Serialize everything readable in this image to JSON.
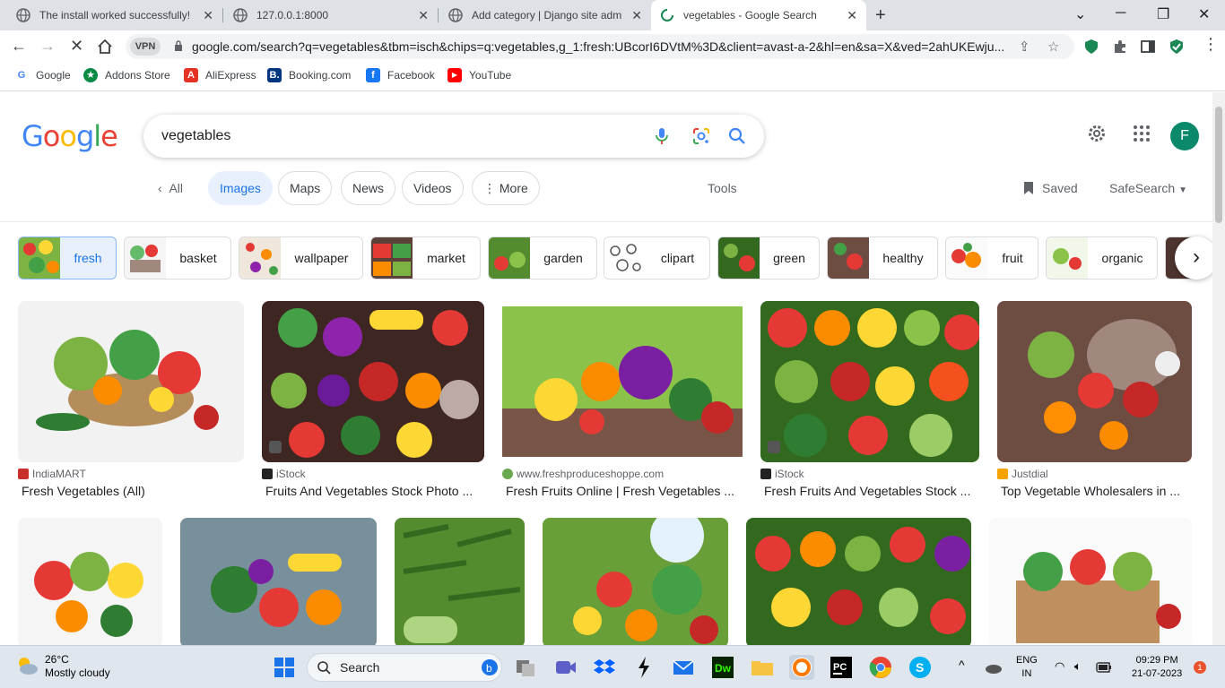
{
  "tabs": [
    {
      "title": "The install worked successfully! C",
      "close": "✕"
    },
    {
      "title": "127.0.0.1:8000",
      "close": "✕"
    },
    {
      "title": "Add category | Django site admin",
      "close": "✕"
    },
    {
      "title": "vegetables - Google Search",
      "close": "✕"
    }
  ],
  "new_tab": "+",
  "address": {
    "vpn": "VPN",
    "url": "google.com/search?q=vegetables&tbm=isch&chips=q:vegetables,g_1:fresh:UBcorI6DVtM%3D&client=avast-a-2&hl=en&sa=X&ved=2ahUKEwju..."
  },
  "bookmarks": [
    {
      "label": "Google",
      "icon": "G",
      "color": "#ffffff"
    },
    {
      "label": "Addons Store",
      "icon": "★",
      "color": "#0b8a44"
    },
    {
      "label": "AliExpress",
      "icon": "A",
      "color": "#e43225"
    },
    {
      "label": "Booking.com",
      "icon": "B.",
      "color": "#003580"
    },
    {
      "label": "Facebook",
      "icon": "f",
      "color": "#1877f2"
    },
    {
      "label": "YouTube",
      "icon": "▶",
      "color": "#ff0000"
    }
  ],
  "search": {
    "query": "vegetables"
  },
  "avatar_letter": "F",
  "nav": {
    "back_all": "All",
    "images": "Images",
    "maps": "Maps",
    "news": "News",
    "videos": "Videos",
    "more": "More",
    "tools": "Tools",
    "saved": "Saved",
    "safesearch": "SafeSearch"
  },
  "chips": [
    "fresh",
    "basket",
    "wallpaper",
    "market",
    "garden",
    "clipart",
    "green",
    "healthy",
    "fruit",
    "organic"
  ],
  "results_row1": [
    {
      "source": "IndiaMART",
      "caption": "Fresh Vegetables (All)",
      "src_color": "#c9302c"
    },
    {
      "source": "iStock",
      "caption": "Fruits And Vegetables Stock Photo ...",
      "src_color": "#222222"
    },
    {
      "source": "www.freshproduceshoppe.com",
      "caption": "Fresh Fruits Online | Fresh Vegetables ...",
      "src_color": "#6aa84f"
    },
    {
      "source": "iStock",
      "caption": "Fresh Fruits And Vegetables Stock ...",
      "src_color": "#222222"
    },
    {
      "source": "Justdial",
      "caption": "Top Vegetable Wholesalers in ...",
      "src_color": "#f4a300"
    }
  ],
  "taskbar": {
    "temp": "26°C",
    "weather": "Mostly cloudy",
    "search": "Search",
    "lang1": "ENG",
    "lang2": "IN",
    "time": "09:29 PM",
    "date": "21-07-2023",
    "notif": "1"
  }
}
